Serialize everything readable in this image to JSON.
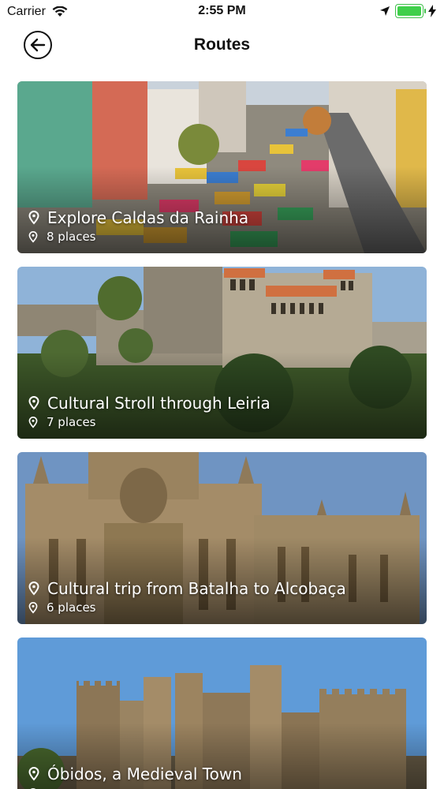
{
  "status_bar": {
    "carrier": "Carrier",
    "time": "2:55 PM",
    "battery_level": 1.0,
    "battery_color": "#3fcf4a",
    "icons": [
      "wifi-icon",
      "location-arrow-icon",
      "battery-icon",
      "charging-bolt-icon"
    ]
  },
  "nav": {
    "title": "Routes",
    "back_icon": "arrow-left-circle-icon"
  },
  "routes": [
    {
      "title": "Explore Caldas da Rainha",
      "places": "8 places",
      "icon": "map-pin-icon"
    },
    {
      "title": "Cultural Stroll through Leiria",
      "places": "7 places",
      "icon": "map-pin-icon"
    },
    {
      "title": "Cultural trip from Batalha to Alcobaça",
      "places": "6 places",
      "icon": "map-pin-icon"
    },
    {
      "title": "Óbidos, a Medieval Town",
      "places": "",
      "icon": "map-pin-icon"
    }
  ]
}
